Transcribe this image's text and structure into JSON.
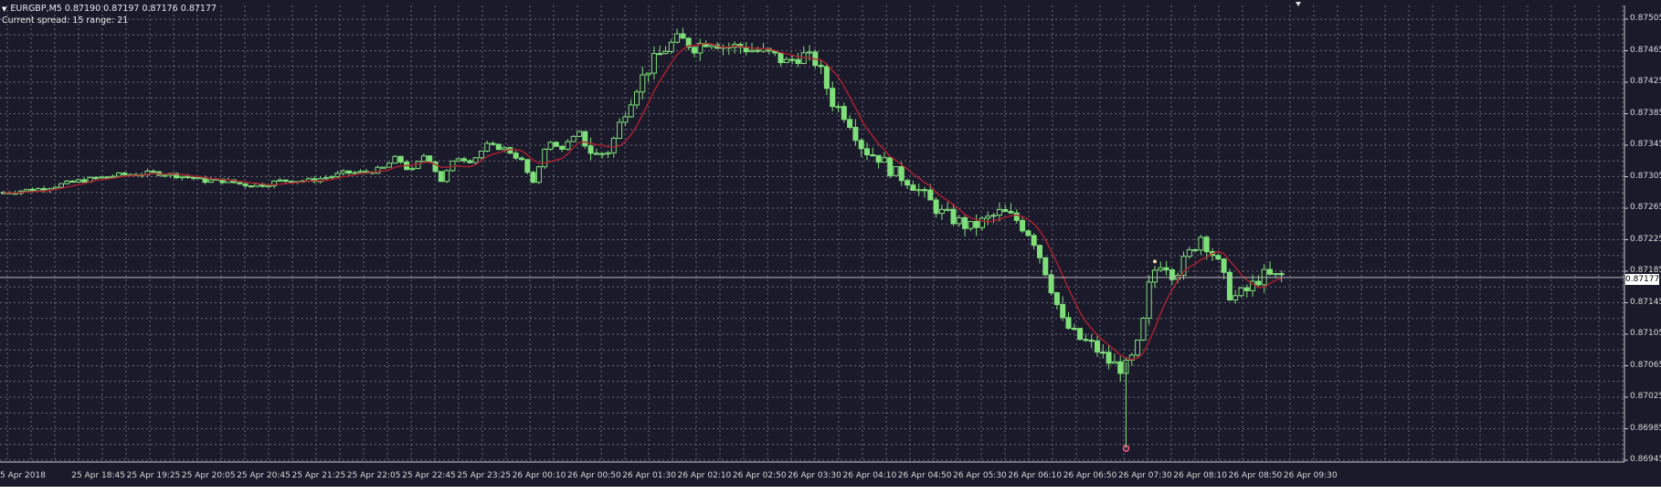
{
  "header": {
    "arrow_icon": "triangle-down-icon",
    "quote": "EURGBP,M5  0.87190 0.87197 0.87176 0.87177",
    "spread": "Current spread: 15 range: 21"
  },
  "price_tag": "0.87177",
  "colors": {
    "background": "#1b1a2b",
    "grid": "#6a6a78",
    "candle": "#7fe07a",
    "moving_average": "#b0202f",
    "axis_text": "#d8d8d8"
  },
  "chart_data": {
    "type": "candlestick",
    "symbol": "EURGBP",
    "timeframe": "M5",
    "y_ticks": [
      "0.87505",
      "0.87465",
      "0.87425",
      "0.87385",
      "0.87345",
      "0.87305",
      "0.87265",
      "0.87225",
      "0.87185",
      "0.87145",
      "0.87105",
      "0.87065",
      "0.87025",
      "0.86985",
      "0.86945"
    ],
    "x_labels": [
      "5 Apr 2018",
      "25 Apr 18:45",
      "25 Apr 19:25",
      "25 Apr 20:05",
      "25 Apr 20:45",
      "25 Apr 21:25",
      "25 Apr 22:05",
      "25 Apr 22:45",
      "25 Apr 23:25",
      "26 Apr 00:10",
      "26 Apr 00:50",
      "26 Apr 01:30",
      "26 Apr 02:10",
      "26 Apr 02:50",
      "26 Apr 03:30",
      "26 Apr 04:10",
      "26 Apr 04:50",
      "26 Apr 05:30",
      "26 Apr 06:10",
      "26 Apr 06:50",
      "26 Apr 07:30",
      "26 Apr 08:10",
      "26 Apr 08:50",
      "26 Apr 09:30"
    ],
    "ylim": [
      0.86945,
      0.87525
    ],
    "current_price": 0.87177,
    "price_path": [
      [
        0,
        0.87285
      ],
      [
        20,
        0.8729
      ],
      [
        40,
        0.873
      ],
      [
        60,
        0.87307
      ],
      [
        80,
        0.8731
      ],
      [
        95,
        0.87305
      ],
      [
        105,
        0.873
      ],
      [
        115,
        0.873
      ],
      [
        125,
        0.87295
      ],
      [
        135,
        0.87295
      ],
      [
        145,
        0.873
      ],
      [
        160,
        0.873
      ],
      [
        170,
        0.87305
      ],
      [
        178,
        0.8731
      ],
      [
        185,
        0.8731
      ],
      [
        192,
        0.87312
      ],
      [
        198,
        0.87316
      ],
      [
        205,
        0.8733
      ],
      [
        212,
        0.8731
      ],
      [
        220,
        0.87335
      ],
      [
        228,
        0.873
      ],
      [
        236,
        0.8733
      ],
      [
        244,
        0.87325
      ],
      [
        252,
        0.87345
      ],
      [
        262,
        0.8734
      ],
      [
        270,
        0.87325
      ],
      [
        276,
        0.87295
      ],
      [
        283,
        0.8735
      ],
      [
        290,
        0.8734
      ],
      [
        300,
        0.8736
      ],
      [
        308,
        0.8733
      ],
      [
        316,
        0.8734
      ],
      [
        324,
        0.8739
      ],
      [
        330,
        0.8742
      ],
      [
        338,
        0.8745
      ],
      [
        346,
        0.8747
      ],
      [
        352,
        0.8748
      ],
      [
        360,
        0.8747
      ],
      [
        368,
        0.8748
      ],
      [
        376,
        0.8747
      ],
      [
        384,
        0.8747
      ],
      [
        392,
        0.87465
      ],
      [
        400,
        0.8746
      ],
      [
        408,
        0.8745
      ],
      [
        416,
        0.8746
      ],
      [
        424,
        0.8745
      ],
      [
        432,
        0.874
      ],
      [
        440,
        0.8738
      ],
      [
        448,
        0.8734
      ],
      [
        456,
        0.8733
      ],
      [
        464,
        0.8731
      ],
      [
        472,
        0.873
      ],
      [
        480,
        0.8728
      ],
      [
        488,
        0.8726
      ],
      [
        496,
        0.8725
      ],
      [
        504,
        0.8724
      ],
      [
        512,
        0.8725
      ],
      [
        520,
        0.8726
      ],
      [
        528,
        0.8725
      ],
      [
        536,
        0.8723
      ],
      [
        544,
        0.8718
      ],
      [
        552,
        0.8712
      ],
      [
        560,
        0.871
      ],
      [
        568,
        0.8709
      ],
      [
        576,
        0.8707
      ],
      [
        584,
        0.8706
      ],
      [
        590,
        0.8708
      ],
      [
        594,
        0.8712
      ],
      [
        598,
        0.8718
      ],
      [
        604,
        0.872
      ],
      [
        610,
        0.8718
      ],
      [
        616,
        0.872
      ],
      [
        624,
        0.8723
      ],
      [
        632,
        0.872
      ],
      [
        640,
        0.8715
      ],
      [
        648,
        0.8716
      ],
      [
        656,
        0.8718
      ],
      [
        662,
        0.87177
      ],
      [
        668,
        0.8718
      ]
    ],
    "low_marker_price": 0.8696,
    "high_marker_price": 0.87195
  }
}
